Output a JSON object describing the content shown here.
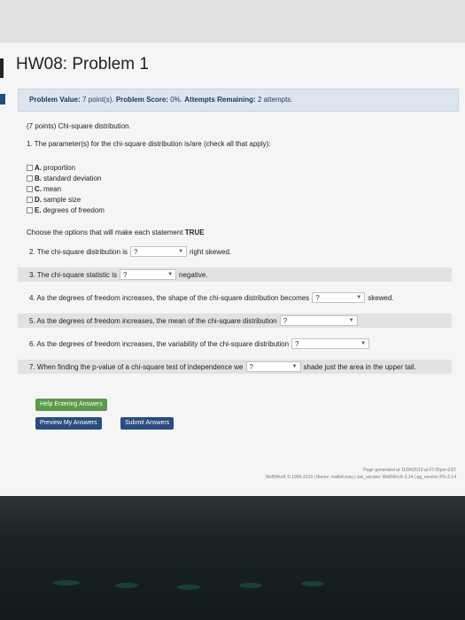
{
  "page": {
    "title": "HW08: Problem 1",
    "problem_value_label": "Problem Value:",
    "problem_value": "7 point(s).",
    "problem_score_label": "Problem Score:",
    "problem_score": "0%.",
    "attempts_label": "Attempts Remaining:",
    "attempts_value": "2 attempts."
  },
  "question": {
    "points_intro": "(7 points) Chi-square distribution.",
    "q1": "1. The parameter(s) for the chi-square distribution is/are (check all that apply):",
    "options": [
      {
        "letter": "A.",
        "text": "proportion"
      },
      {
        "letter": "B.",
        "text": "standard deviation"
      },
      {
        "letter": "C.",
        "text": "mean"
      },
      {
        "letter": "D.",
        "text": "sample size"
      },
      {
        "letter": "E.",
        "text": "degrees of freedom"
      }
    ],
    "instr_prefix": "Choose the options that will make each statement",
    "instr_bold": "TRUE",
    "statements": [
      {
        "before": "2. The chi-square distribution is",
        "select": "?",
        "after": "right skewed."
      },
      {
        "before": "3. The chi-square statistic is",
        "select": "?",
        "after": "negative."
      },
      {
        "before": "4. As the degrees of freedom increases, the shape of the chi-square distribution becomes",
        "select": "?",
        "after": "skewed."
      },
      {
        "before": "5. As the degrees of freedom increases, the mean of the chi-square distribution",
        "select": "?",
        "after": ""
      },
      {
        "before": "6. As the degrees of freedom increases, the variability of the chi-square distribution",
        "select": "?",
        "after": ""
      },
      {
        "before": "7. When finding the p-value of a chi-square test of independence we",
        "select": "?",
        "after": "shade just the area in the upper tail."
      }
    ]
  },
  "buttons": {
    "help": "Help Entering Answers",
    "preview": "Preview My Answers",
    "submit": "Submit Answers"
  },
  "footer": {
    "line1": "Page generated at 11/04/2019 at 07:05pm EST",
    "line2": "WeBWorK © 1996-2019 | theme: math4-msu | ww_version: WeBWorK-2.14 | pg_version PG-2.14"
  },
  "colors": {
    "accent": "#2b4c80",
    "help_button": "#5b9a48",
    "info_bar": "#dde6f0"
  }
}
